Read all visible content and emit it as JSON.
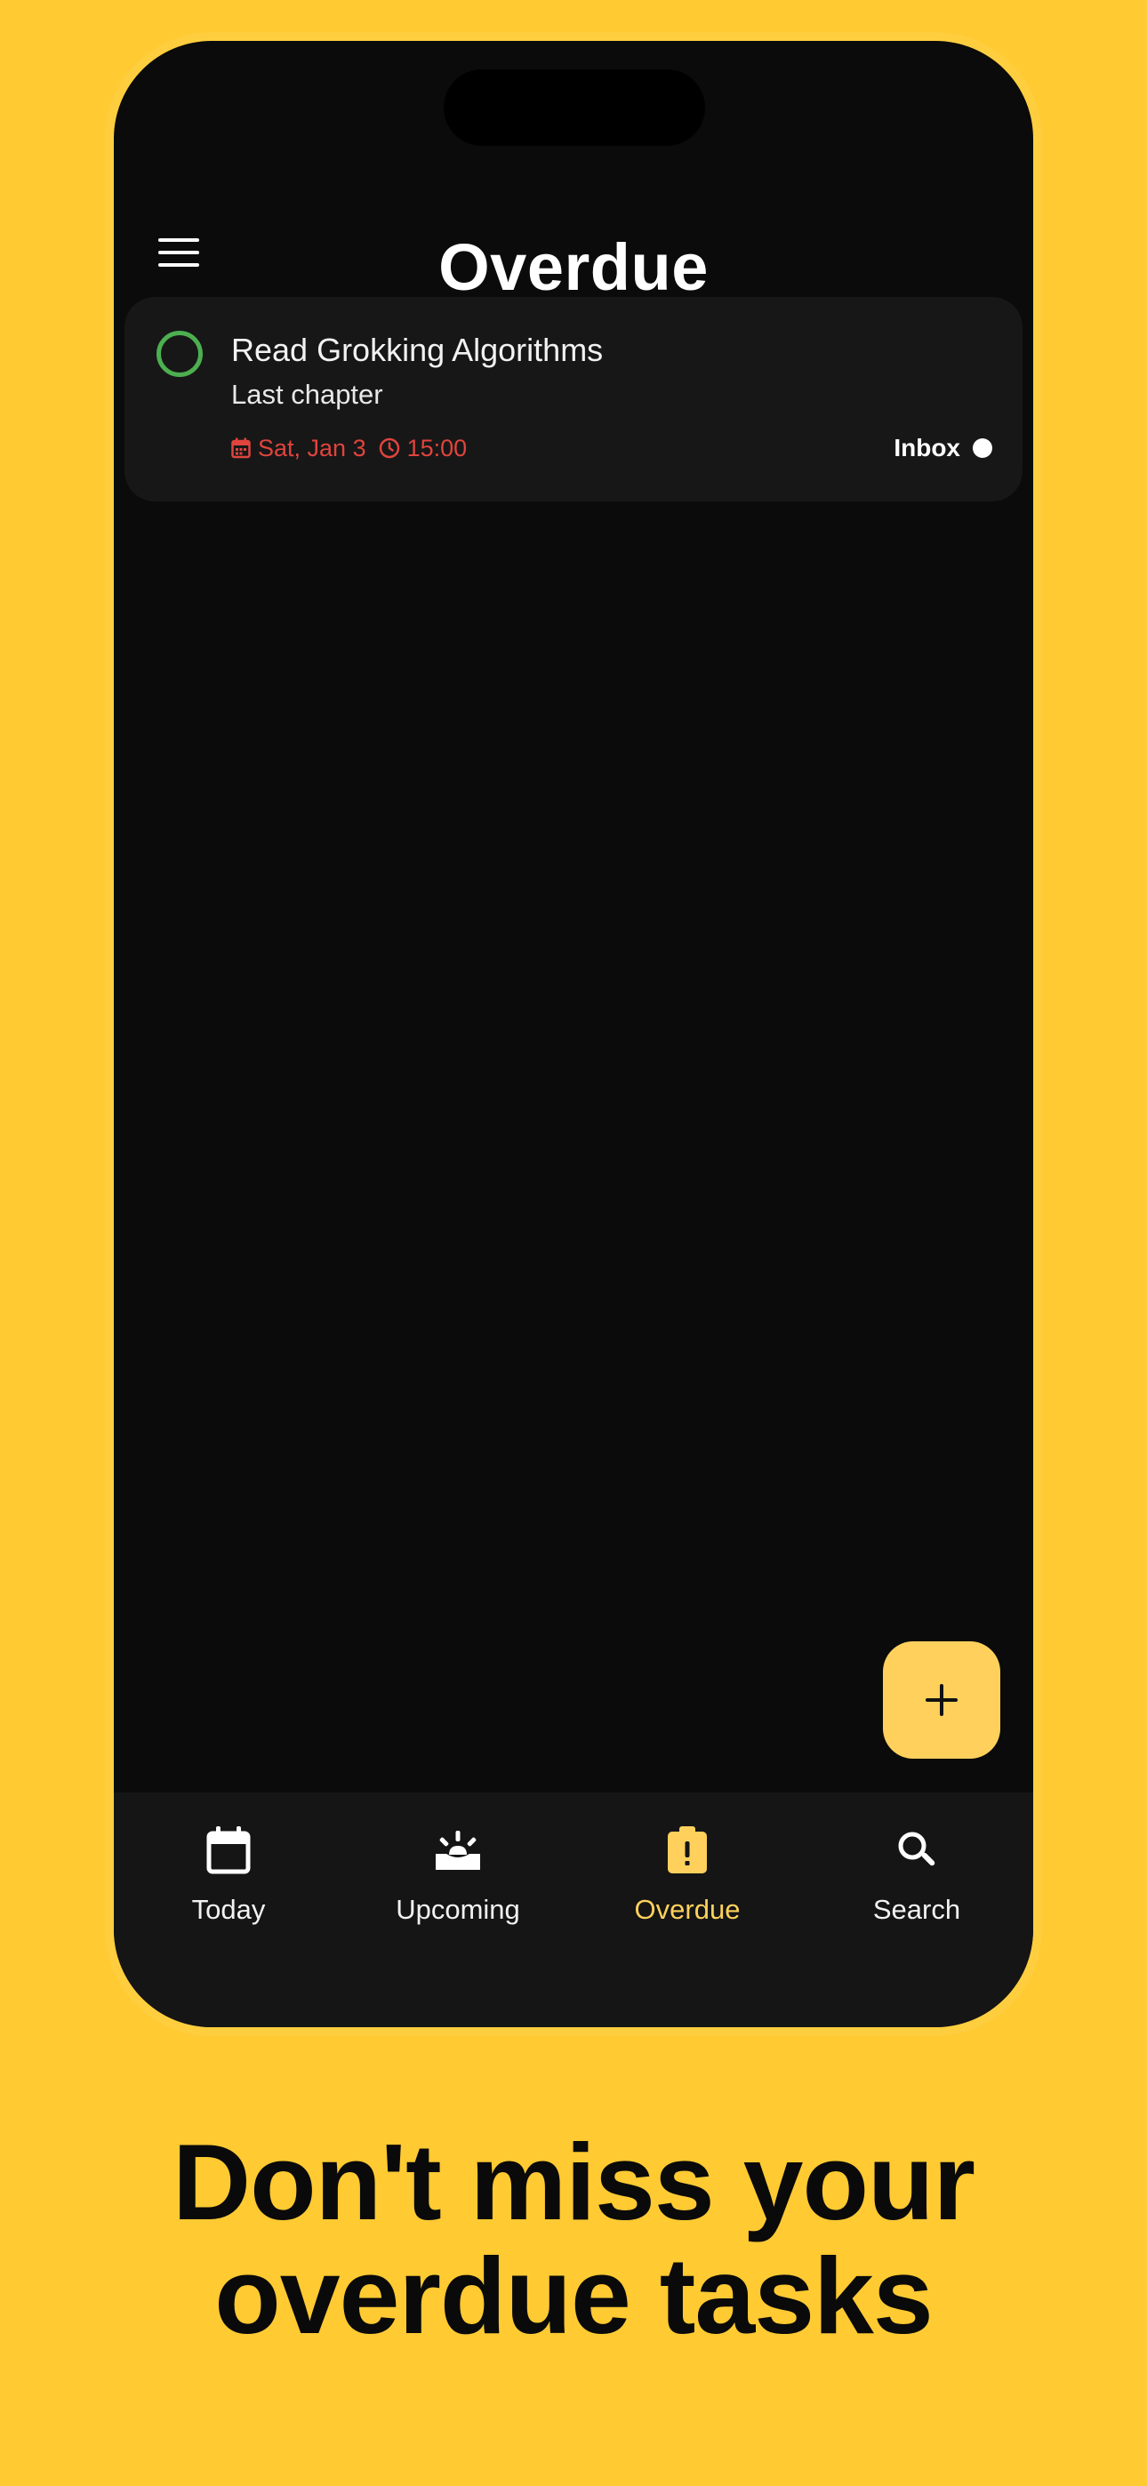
{
  "header": {
    "title": "Overdue",
    "menu_icon": "hamburger-menu-icon"
  },
  "task": {
    "title": "Read Grokking Algorithms",
    "description": "Last chapter",
    "date": "Sat, Jan 3",
    "time": "15:00",
    "project": "Inbox",
    "status_color": "#4CAF50",
    "overdue_color": "#E0443E"
  },
  "fab": {
    "icon": "plus-icon"
  },
  "bottom_nav": {
    "items": [
      {
        "label": "Today",
        "icon": "calendar-icon",
        "active": false
      },
      {
        "label": "Upcoming",
        "icon": "upcoming-icon",
        "active": false
      },
      {
        "label": "Overdue",
        "icon": "overdue-clipboard-icon",
        "active": true
      },
      {
        "label": "Search",
        "icon": "search-icon",
        "active": false
      }
    ]
  },
  "headline": {
    "line1": "Don't miss your",
    "line2": "overdue tasks"
  },
  "colors": {
    "background": "#FFCA32",
    "accent": "#FFD15C",
    "screen": "#0B0B0B",
    "card": "#171717"
  }
}
